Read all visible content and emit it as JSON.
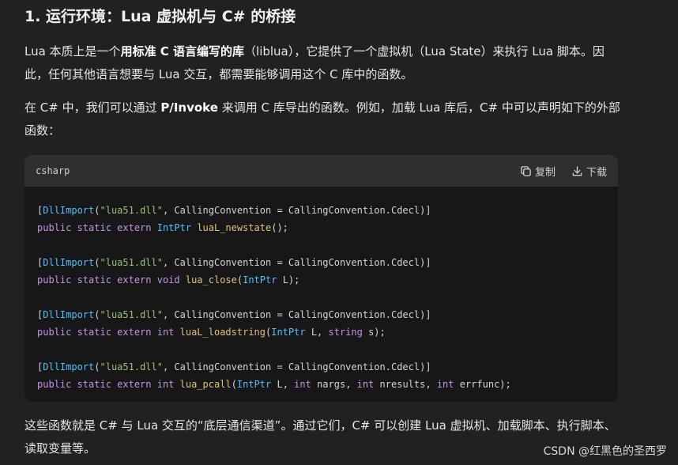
{
  "heading": "1. 运行环境：Lua 虚拟机与 C# 的桥接",
  "para1": {
    "a": "Lua 本质上是一个",
    "b": "用标准 C 语言编写的库",
    "c": "（liblua），它提供了一个虚拟机（Lua State）来执行 Lua 脚本。因此，任何其他语言想要与 Lua 交互，都需要能够调用这个 C 库中的函数。"
  },
  "para2": {
    "a": "在 C# 中，我们可以通过 ",
    "b": "P/Invoke",
    "c": " 来调用 C 库导出的函数。例如，加载 Lua 库后，C# 中可以声明如下的外部函数："
  },
  "code": {
    "language": "csharp",
    "copy_label": "复制",
    "download_label": "下载",
    "blocks": [
      {
        "attr": {
          "open": "[",
          "name": "DllImport",
          "paren": "(",
          "str": "\"lua51.dll\"",
          "rest": ", CallingConvention = CallingConvention.Cdecl)]"
        },
        "decl": [
          {
            "t": "kw",
            "v": "public static extern "
          },
          {
            "t": "type",
            "v": "IntPtr"
          },
          {
            "t": "plain",
            "v": " "
          },
          {
            "t": "fn",
            "v": "luaL_newstate"
          },
          {
            "t": "plain",
            "v": "();"
          }
        ]
      },
      {
        "attr": {
          "open": "[",
          "name": "DllImport",
          "paren": "(",
          "str": "\"lua51.dll\"",
          "rest": ", CallingConvention = CallingConvention.Cdecl)]"
        },
        "decl": [
          {
            "t": "kw",
            "v": "public static extern void "
          },
          {
            "t": "fn",
            "v": "lua_close"
          },
          {
            "t": "plain",
            "v": "("
          },
          {
            "t": "type",
            "v": "IntPtr"
          },
          {
            "t": "plain",
            "v": " L);"
          }
        ]
      },
      {
        "attr": {
          "open": "[",
          "name": "DllImport",
          "paren": "(",
          "str": "\"lua51.dll\"",
          "rest": ", CallingConvention = CallingConvention.Cdecl)]"
        },
        "decl": [
          {
            "t": "kw",
            "v": "public static extern int "
          },
          {
            "t": "fn",
            "v": "luaL_loadstring"
          },
          {
            "t": "plain",
            "v": "("
          },
          {
            "t": "type",
            "v": "IntPtr"
          },
          {
            "t": "plain",
            "v": " L, "
          },
          {
            "t": "kw",
            "v": "string"
          },
          {
            "t": "plain",
            "v": " s);"
          }
        ]
      },
      {
        "attr": {
          "open": "[",
          "name": "DllImport",
          "paren": "(",
          "str": "\"lua51.dll\"",
          "rest": ", CallingConvention = CallingConvention.Cdecl)]"
        },
        "decl": [
          {
            "t": "kw",
            "v": "public static extern int "
          },
          {
            "t": "fn",
            "v": "lua_pcall"
          },
          {
            "t": "plain",
            "v": "("
          },
          {
            "t": "type",
            "v": "IntPtr"
          },
          {
            "t": "plain",
            "v": " L, "
          },
          {
            "t": "kw",
            "v": "int"
          },
          {
            "t": "plain",
            "v": " nargs, "
          },
          {
            "t": "kw",
            "v": "int"
          },
          {
            "t": "plain",
            "v": " nresults, "
          },
          {
            "t": "kw",
            "v": "int"
          },
          {
            "t": "plain",
            "v": " errfunc);"
          }
        ]
      }
    ]
  },
  "para3": "这些函数就是 C# 与 Lua 交互的“底层通信渠道”。通过它们，C# 可以创建 Lua 虚拟机、加载脚本、执行脚本、读取变量等。",
  "watermark": "CSDN @红黑色的圣西罗",
  "icons": {
    "copy": "copy-icon",
    "download": "download-icon"
  }
}
